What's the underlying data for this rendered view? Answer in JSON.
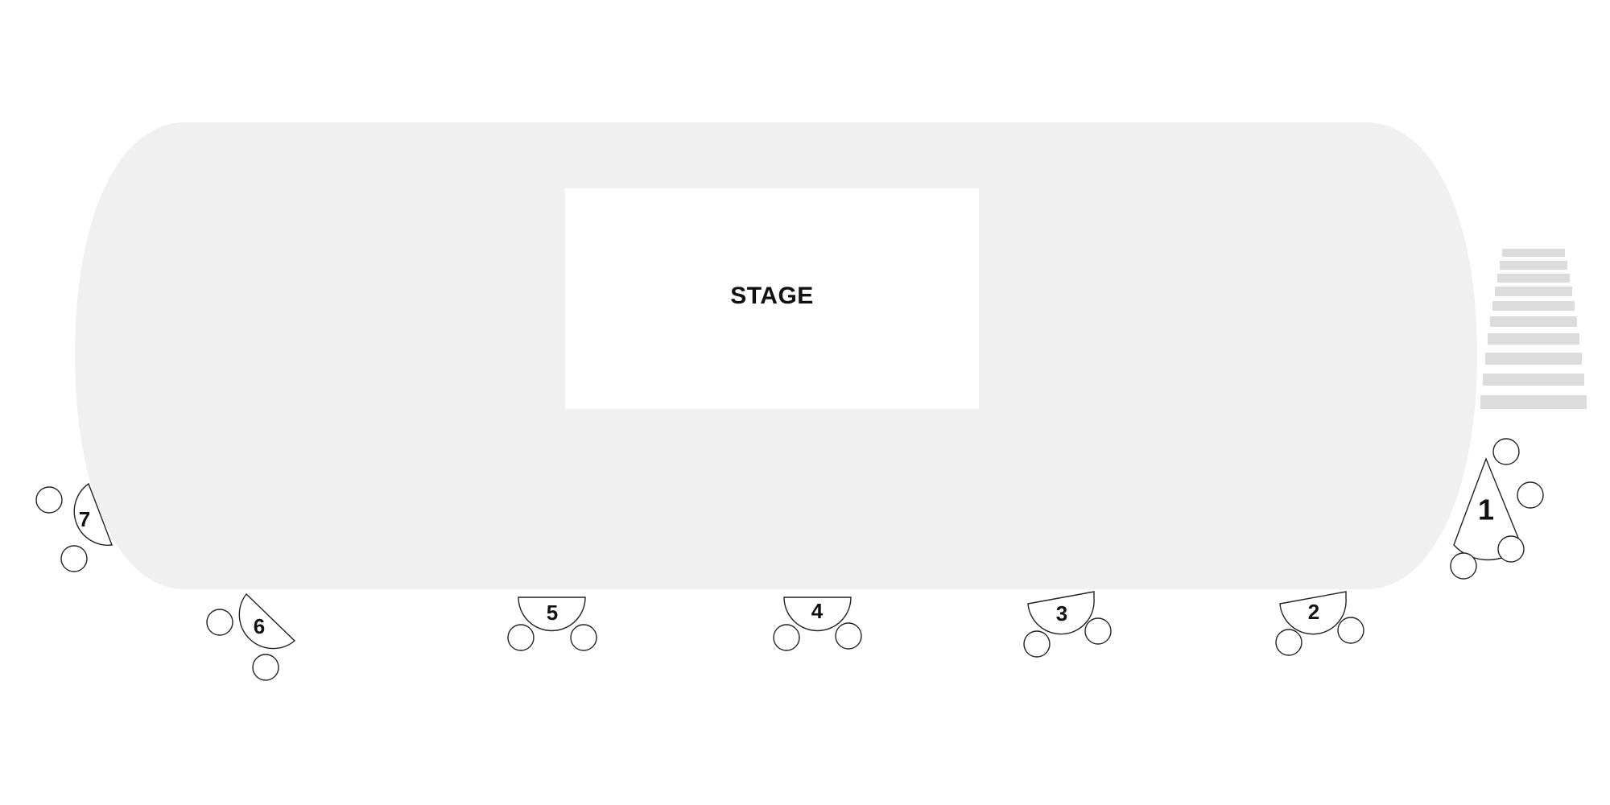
{
  "stage": {
    "label": "STAGE"
  },
  "tables": [
    {
      "number": "1",
      "seats": 4
    },
    {
      "number": "2",
      "seats": 2
    },
    {
      "number": "3",
      "seats": 2
    },
    {
      "number": "4",
      "seats": 2
    },
    {
      "number": "5",
      "seats": 2
    },
    {
      "number": "6",
      "seats": 2
    },
    {
      "number": "7",
      "seats": 2
    }
  ],
  "colors": {
    "floor": "#f0f0f0",
    "stage": "#ffffff",
    "steps": "#dcdcdc",
    "outline": "#222222"
  }
}
